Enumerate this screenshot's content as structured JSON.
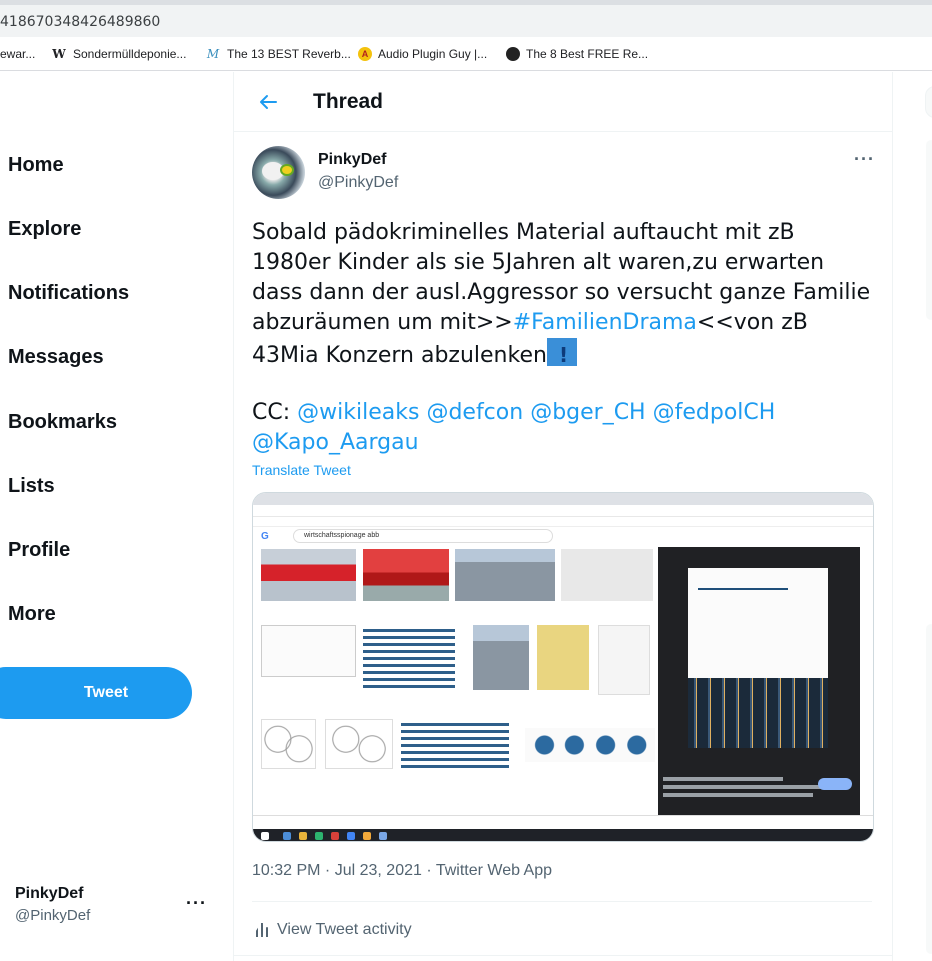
{
  "browser": {
    "url": "418670348426489860",
    "bookmarks": [
      {
        "label": "ewar...",
        "icon": "none"
      },
      {
        "label": "Sondermülldeponie...",
        "icon": "wikipedia-icon"
      },
      {
        "label": "The 13 BEST Reverb...",
        "icon": "musician-on-a-mission-icon"
      },
      {
        "label": "Audio Plugin Guy |...",
        "icon": "audio-plugin-guy-icon"
      },
      {
        "label": "The 8 Best FREE Re...",
        "icon": "site-icon"
      }
    ]
  },
  "nav": {
    "items": [
      "Home",
      "Explore",
      "Notifications",
      "Messages",
      "Bookmarks",
      "Lists",
      "Profile",
      "More"
    ],
    "tweet_button": "Tweet",
    "account": {
      "name": "PinkyDef",
      "handle": "@PinkyDef",
      "more": "···"
    }
  },
  "header": {
    "title": "Thread"
  },
  "tweet": {
    "author_name": "PinkyDef",
    "author_handle": "@PinkyDef",
    "more": "···",
    "text_before": "Sobald pädokriminelles Material auftaucht mit zB 1980er Kinder als sie 5Jahren alt waren,zu erwarten dass dann der ausl.Aggressor so versucht ganze Familie abzuräumen um mit>>",
    "hashtag": "#FamilienDrama",
    "text_after": "<<von zB 43Mia Konzern abzulenken",
    "emoji": "warning-sign",
    "cc_prefix": "CC: ",
    "mentions": [
      "@wikileaks",
      "@defcon",
      "@bger_CH",
      "@fedpolCH",
      "@Kapo_Aargau"
    ],
    "translate": "Translate Tweet",
    "image_search_query": "wirtschaftsspionage abb",
    "timestamp": "10:32 PM · Jul 23, 2021 · Twitter Web App",
    "activity": "View Tweet activity"
  },
  "colors": {
    "accent": "#1d9bf0",
    "text": "#0f1419",
    "secondary": "#536471"
  }
}
